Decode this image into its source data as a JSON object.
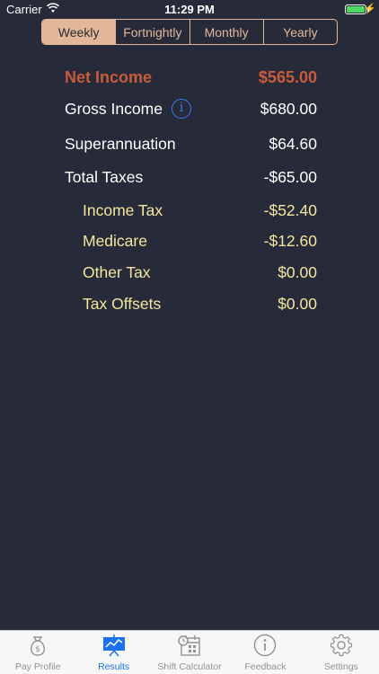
{
  "status_bar": {
    "carrier": "Carrier",
    "time": "11:29 PM",
    "battery_level": 1.0
  },
  "period_tabs": [
    "Weekly",
    "Fortnightly",
    "Monthly",
    "Yearly"
  ],
  "selected_period": "Weekly",
  "results": {
    "net_income": {
      "label": "Net Income",
      "value": "$565.00"
    },
    "gross_income": {
      "label": "Gross Income",
      "value": "$680.00",
      "info_glyph": "i"
    },
    "superannuation": {
      "label": "Superannuation",
      "value": "$64.60"
    },
    "total_taxes": {
      "label": "Total Taxes",
      "value": "-$65.00"
    },
    "income_tax": {
      "label": "Income Tax",
      "value": "-$52.40"
    },
    "medicare": {
      "label": "Medicare",
      "value": "-$12.60"
    },
    "other_tax": {
      "label": "Other Tax",
      "value": "$0.00"
    },
    "tax_offsets": {
      "label": "Tax Offsets",
      "value": "$0.00"
    }
  },
  "tab_bar": [
    {
      "label": "Pay Profile",
      "icon": "money-bag-icon"
    },
    {
      "label": "Results",
      "icon": "presentation-chart-icon",
      "active": true
    },
    {
      "label": "Shift Calculator",
      "icon": "calendar-clock-icon"
    },
    {
      "label": "Feedback",
      "icon": "info-circle-icon"
    },
    {
      "label": "Settings",
      "icon": "gear-icon"
    }
  ],
  "colors": {
    "background": "#272a38",
    "accent": "#e2b79a",
    "net_income": "#c85b3c",
    "sub_item": "#f3e6a0",
    "info": "#3b7df2",
    "tab_active": "#1a72f0"
  }
}
